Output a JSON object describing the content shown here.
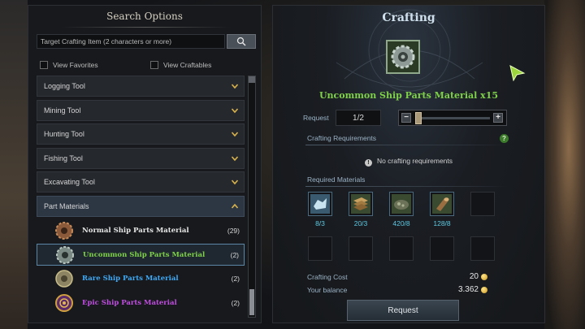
{
  "search_options": {
    "title": "Search Options",
    "search_placeholder": "Target Crafting Item (2 characters or more)",
    "view_favorites_label": "View Favorites",
    "view_craftables_label": "View Craftables",
    "categories": [
      {
        "label": "Logging Tool"
      },
      {
        "label": "Mining Tool"
      },
      {
        "label": "Hunting Tool"
      },
      {
        "label": "Fishing Tool"
      },
      {
        "label": "Excavating Tool"
      },
      {
        "label": "Part Materials"
      }
    ],
    "items": [
      {
        "name": "Normal Ship Parts Material",
        "count": "(29)",
        "color": "#e6e6e6"
      },
      {
        "name": "Uncommon Ship Parts Material",
        "count": "(2)",
        "color": "#7fd14a"
      },
      {
        "name": "Rare Ship Parts Material",
        "count": "(2)",
        "color": "#3fa9f5"
      },
      {
        "name": "Epic Ship Parts Material",
        "count": "(2)",
        "color": "#c04ee0"
      }
    ]
  },
  "crafting": {
    "title": "Crafting",
    "product_name": "Uncommon Ship Parts Material x15",
    "request_label": "Request",
    "request_value": "1/2",
    "slider_fraction": 0.02,
    "requirements_label": "Crafting Requirements",
    "help_icon": "?",
    "no_requirements_text": "No crafting requirements",
    "required_materials_label": "Required Materials",
    "materials": [
      {
        "icon": "crystal-icon",
        "count": "8/3"
      },
      {
        "icon": "planks-icon",
        "count": "20/3"
      },
      {
        "icon": "ore-icon",
        "count": "420/8"
      },
      {
        "icon": "log-icon",
        "count": "128/8"
      }
    ],
    "cost_label": "Crafting Cost",
    "cost_value": "20",
    "balance_label": "Your balance",
    "balance_value": "3.362",
    "request_button": "Request"
  }
}
